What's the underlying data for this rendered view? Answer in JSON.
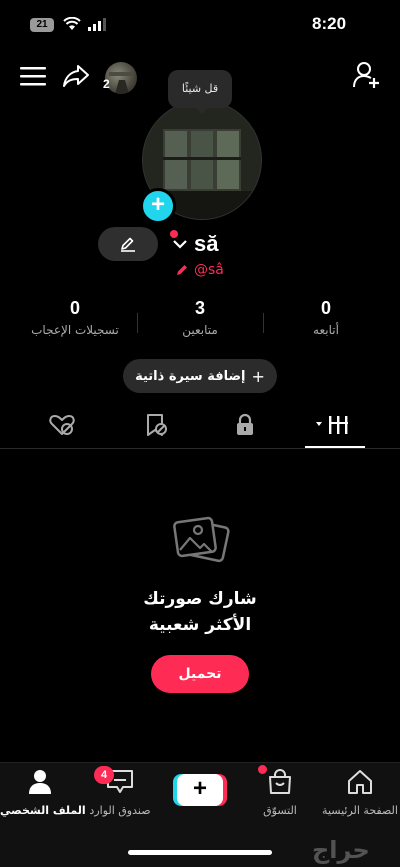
{
  "status_bar": {
    "time": "8:20",
    "battery": "21"
  },
  "header": {
    "friends_count": "2"
  },
  "profile": {
    "bubble_text": "قل شيئًا",
    "username": "să",
    "handle": "@sâ"
  },
  "stats": [
    {
      "value": "0",
      "label": "أتابعه"
    },
    {
      "value": "3",
      "label": "متابعين"
    },
    {
      "value": "0",
      "label": "تسجيلات الإعجاب"
    }
  ],
  "bio_button": "إضافة سيرة ذاتية",
  "empty_state": {
    "title_line1": "شارك صورتك",
    "title_line2": "الأكثر شعبية",
    "upload_label": "تحميل"
  },
  "bottom_nav": {
    "home": "الصفحة الرئيسية",
    "shop": "التسوّق",
    "create": "+",
    "inbox": "صندوق الوارد",
    "inbox_badge": "4",
    "profile": "الملف الشخصي"
  },
  "watermark": "حراج",
  "colors": {
    "accent_red": "#fe2c55",
    "accent_cyan": "#20d5ec",
    "background": "#000000"
  }
}
